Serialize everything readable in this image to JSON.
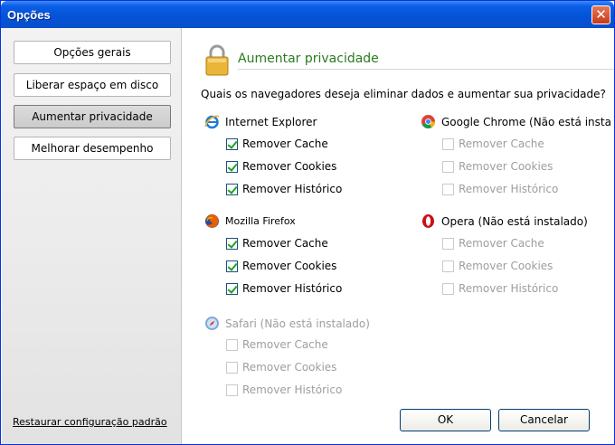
{
  "window": {
    "title": "Opções",
    "close_glyph": "✕"
  },
  "sidebar": {
    "items": [
      {
        "label": "Opções gerais"
      },
      {
        "label": "Liberar espaço em disco"
      },
      {
        "label": "Aumentar privacidade"
      },
      {
        "label": "Melhorar desempenho"
      }
    ],
    "restore_link": "Restaurar configuração padrão"
  },
  "main": {
    "section_title": "Aumentar privacidade",
    "question": "Quais os navegadores deseja eliminar dados e aumentar sua privacidade?",
    "browsers": {
      "ie": {
        "name": "Internet Explorer",
        "icon": "internet-explorer-icon",
        "options": [
          {
            "label": "Remover Cache",
            "checked": true
          },
          {
            "label": "Remover Cookies",
            "checked": true
          },
          {
            "label": "Remover Histórico",
            "checked": true
          }
        ]
      },
      "chrome": {
        "name": "Google Chrome (Não está insta",
        "icon": "chrome-icon",
        "options": [
          {
            "label": "Remover Cache",
            "checked": false
          },
          {
            "label": "Remover Cookies",
            "checked": false
          },
          {
            "label": "Remover Histórico",
            "checked": false
          }
        ]
      },
      "firefox": {
        "name": "Mozilla Firefox",
        "icon": "firefox-icon",
        "options": [
          {
            "label": "Remover Cache",
            "checked": true
          },
          {
            "label": "Remover Cookies",
            "checked": true
          },
          {
            "label": "Remover Histórico",
            "checked": true
          }
        ]
      },
      "opera": {
        "name": "Opera (Não está instalado)",
        "icon": "opera-icon",
        "options": [
          {
            "label": "Remover Cache",
            "checked": false
          },
          {
            "label": "Remover Cookies",
            "checked": false
          },
          {
            "label": "Remover Histórico",
            "checked": false
          }
        ]
      },
      "safari": {
        "name": "Safari (Não está instalado)",
        "icon": "safari-icon",
        "options": [
          {
            "label": "Remover Cache",
            "checked": false
          },
          {
            "label": "Remover Cookies",
            "checked": false
          },
          {
            "label": "Remover Histórico",
            "checked": false
          }
        ]
      }
    }
  },
  "buttons": {
    "ok": "OK",
    "cancel": "Cancelar"
  },
  "colors": {
    "title_bar": "#0A5DE6",
    "section_title": "#2A7B1E",
    "check": "#21A121",
    "disabled_text": "#9E9E9E"
  }
}
